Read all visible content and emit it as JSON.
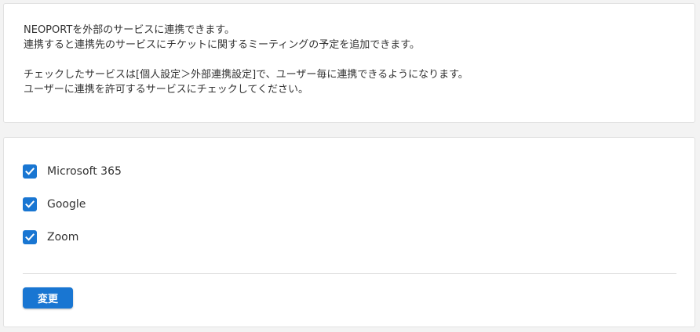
{
  "info": {
    "lines": [
      "NEOPORTを外部のサービスに連携できます。",
      "連携すると連携先のサービスにチケットに関するミーティングの予定を追加できます。",
      "チェックしたサービスは[個人設定＞外部連携設定]で、ユーザー毎に連携できるようになります。",
      "ユーザーに連携を許可するサービスにチェックしてください。"
    ]
  },
  "services": [
    {
      "label": "Microsoft 365",
      "checked": true
    },
    {
      "label": "Google",
      "checked": true
    },
    {
      "label": "Zoom",
      "checked": true
    }
  ],
  "actions": {
    "submit_label": "変更"
  },
  "colors": {
    "accent": "#1976d2",
    "background": "#f3f3f3",
    "card": "#ffffff"
  },
  "icons": {
    "checkbox": "checkmark-icon"
  }
}
